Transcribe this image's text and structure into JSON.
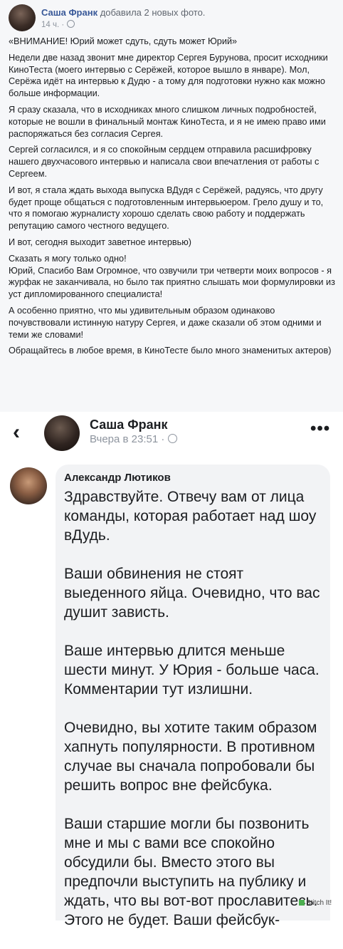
{
  "post": {
    "author": "Саша Франк",
    "action": "добавила 2 новых фото.",
    "time": "14 ч. ·",
    "paragraphs": [
      "«ВНИМАНИЕ! Юрий может сдуть, сдуть может Юрий»",
      "Недели две назад звонит мне директор Сергея Бурунова, просит исходники КиноТеста (моего интервью с Серёжей, которое вышло в январе). Мол, Серёжа идёт на интервью к Дудю - а тому для подготовки нужно как можно больше информации.",
      "Я сразу сказала, что в исходниках много слишком личных подробностей, которые не вошли в финальный монтаж КиноТеста, и я не имею право ими распоряжаться без согласия Сергея.",
      "Сергей согласился, и я со спокойным сердцем отправила расшифровку нашего двухчасового интервью и написала свои впечатления от работы с Сергеем.",
      "И вот, я стала ждать выхода выпуска ВДудя с Серёжей, радуясь, что другу будет проще общаться с подготовленным интервьюером. Грело душу и то, что я помогаю журналисту хорошо сделать свою работу и поддержать репутацию самого честного ведущего.",
      "И вот, сегодня выходит заветное интервью)",
      "Сказать я могу только одно!",
      "Юрий, Спасибо Вам Огромное, что озвучили три четверти моих вопросов - я журфак не заканчивала, но было так приятно слышать мои формулировки из уст дипломированного специалиста!",
      "А особенно приятно, что мы удивительным образом одинаково почувствовали истинную натуру Сергея, и даже сказали об этом одними и теми же словами!",
      "Обращайтесь в любое время, в КиноТесте было много знаменитых актеров)"
    ]
  },
  "header": {
    "back_icon": "‹",
    "name": "Саша Франк",
    "meta": "Вчера в 23:51 ·",
    "more_icon": "•••"
  },
  "comment": {
    "author": "Александр Лютиков",
    "paragraphs": [
      "Здравствуйте. Отвечу вам от лица команды, которая работает над шоу вДудь.",
      "Ваши обвинения не стоят выеденного яйца. Очевидно, что вас душит зависть.",
      "Ваше интервью длится меньше шести минут. У Юрия - больше часа. Комментарии тут излишни.",
      "Очевидно, вы хотите таким образом хапнуть популярности. В противном случае вы сначала попробовали бы решить вопрос вне фейсбука.",
      "Ваши старшие могли бы позвонить мне и мы с вами все спокойно обсудили бы. Вместо этого вы предпочли выступить на публику и ждать, что вы вот-вот прославитесь. Этого не будет. Ваши фейсбук-"
    ]
  },
  "watermark": "Stitch It!"
}
